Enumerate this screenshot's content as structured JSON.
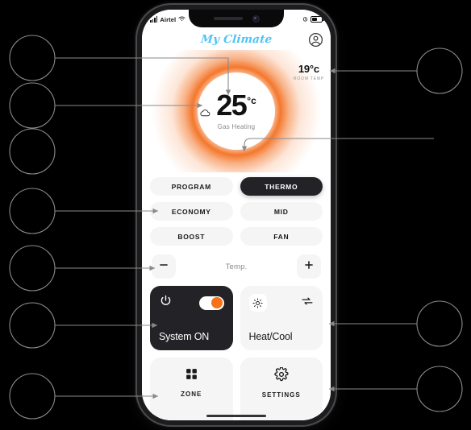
{
  "statusbar": {
    "carrier": "Airtel",
    "signal_icon": "signal-bars-icon",
    "wifi_icon": "wifi-icon",
    "alarm_icon": "alarm-icon",
    "battery_icon": "battery-icon"
  },
  "header": {
    "title": "My Climate",
    "avatar_icon": "account-circle-icon",
    "title_color": "#4fc3f7"
  },
  "hero": {
    "target_temp": "25",
    "target_unit": "°c",
    "mode_text": "Gas Heating",
    "weather_icon": "cloud-icon",
    "glow_color": "#f37021",
    "room": {
      "value": "19°c",
      "label": "ROOM TEMP"
    }
  },
  "modes": {
    "items": [
      {
        "label": "PROGRAM",
        "active": false
      },
      {
        "label": "THERMO",
        "active": true
      },
      {
        "label": "ECONOMY",
        "active": false
      },
      {
        "label": "MID",
        "active": false
      },
      {
        "label": "BOOST",
        "active": false
      },
      {
        "label": "FAN",
        "active": false
      }
    ]
  },
  "stepper": {
    "minus_icon": "minus-icon",
    "label": "Temp.",
    "plus_icon": "plus-icon"
  },
  "cards": {
    "system": {
      "label": "System ON",
      "power_icon": "power-icon",
      "toggle_state": "on",
      "toggle_accent": "#f97316",
      "bg": "#232327"
    },
    "heatcool": {
      "label": "Heat/Cool",
      "sun_icon": "sun-icon",
      "swap_icon": "refresh-swap-icon",
      "bg": "#f5f5f6"
    }
  },
  "bottomnav": {
    "items": [
      {
        "label": "ZONE",
        "icon": "grid-icon"
      },
      {
        "label": "SETTINGS",
        "icon": "gear-icon"
      }
    ]
  },
  "annotations": {
    "callout_count": 9,
    "circle_color": "#8a8a8a",
    "line_color": "#8a8a8a"
  }
}
